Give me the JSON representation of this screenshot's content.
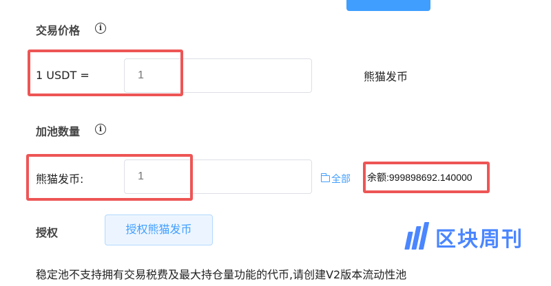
{
  "price_section": {
    "title": "交易价格",
    "info_icon": "ⓘ",
    "label": "1 USDT =",
    "input_placeholder": "1",
    "unit": "熊猫发币"
  },
  "pool_section": {
    "title": "加池数量",
    "info_icon": "ⓘ",
    "label": "熊猫发币:",
    "input_placeholder": "1",
    "max_label": "全部",
    "balance_text": "余额:999898692.140000"
  },
  "auth": {
    "label": "授权",
    "button_label": "授权熊猫发币"
  },
  "note": "稳定池不支持拥有交易税费及最大持仓量功能的代币,请创建V2版本流动性池",
  "watermark": {
    "text": "区块周刊"
  },
  "colors": {
    "accent": "#409eff",
    "highlight": "#ee5555",
    "watermark": "#4a86ff"
  }
}
